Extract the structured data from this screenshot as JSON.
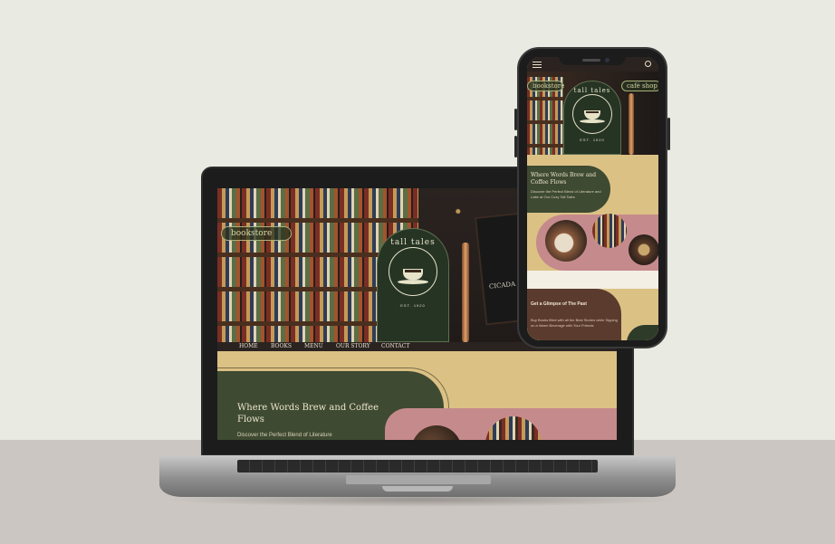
{
  "laptop": {
    "screen": {
      "bookstore_button": "bookstore",
      "logo": {
        "name": "tall tales",
        "established": "EST. 1920"
      },
      "chalkboard_text": "CICADA",
      "nav": [
        "HOME",
        "BOOKS",
        "MENU",
        "OUR STORY",
        "CONTACT"
      ],
      "hero_heading": "Where Words Brew and Coffee Flows",
      "hero_subtext": "Discover the Perfect Blend of Literature"
    }
  },
  "phone": {
    "screen": {
      "bookstore_button": "bookstore",
      "cafe_button": "café shop",
      "logo": {
        "name": "tall tales",
        "established": "EST. 1920"
      },
      "heading": "Where Words Brew and Coffee Flows",
      "subtext": "Discover the Perfect Blend of Literature and Latte at Our Cozy Tall Tales",
      "glimpse_heading": "Get a Glimpse of The Past",
      "glimpse_text": "Buy Books filled with all the Best Stories while Sipping on a Warm Beverage with Your Friends"
    }
  },
  "colors": {
    "dark_green": "#263424",
    "olive": "#3e4a31",
    "sand": "#dcc185",
    "rose": "#c58a8c",
    "brown": "#5b3b2e",
    "background": "#e9eae2"
  }
}
